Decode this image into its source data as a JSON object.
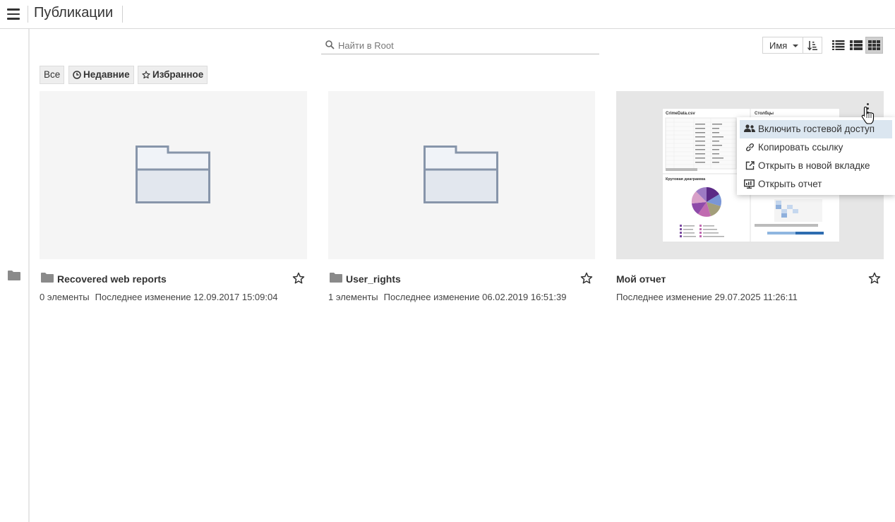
{
  "header": {
    "title": "Публикации"
  },
  "search": {
    "placeholder": "Найти в Root",
    "value": ""
  },
  "sort": {
    "selected": "Имя"
  },
  "view_modes": [
    "list",
    "detailed-list",
    "grid"
  ],
  "filters": [
    {
      "label": "Все",
      "icon": null
    },
    {
      "label": "Недавние",
      "icon": "clock-icon"
    },
    {
      "label": "Избранное",
      "icon": "star-icon"
    }
  ],
  "items": [
    {
      "title": "Recovered web reports",
      "type": "folder",
      "count": "0 элементы",
      "modified": "Последнее изменение 12.09.2017 15:09:04"
    },
    {
      "title": "User_rights",
      "type": "folder",
      "count": "1 элементы",
      "modified": "Последнее изменение 06.02.2019 16:51:39"
    },
    {
      "title": "Мой отчет",
      "type": "report",
      "modified": "Последнее изменение 29.07.2025 11:26:11"
    }
  ],
  "context_menu": {
    "items": [
      {
        "label": "Включить гостевой доступ",
        "icon": "users-icon",
        "highlighted": true
      },
      {
        "label": "Копировать ссылку",
        "icon": "link-icon"
      },
      {
        "label": "Открыть в новой вкладке",
        "icon": "external-link-icon"
      },
      {
        "label": "Открыть отчет",
        "icon": "monitor-icon"
      }
    ]
  },
  "report_preview": {
    "table_title": "CrimeData.csv",
    "columns_title": "Столбцы",
    "pie_title": "Круговая диаграмма"
  }
}
